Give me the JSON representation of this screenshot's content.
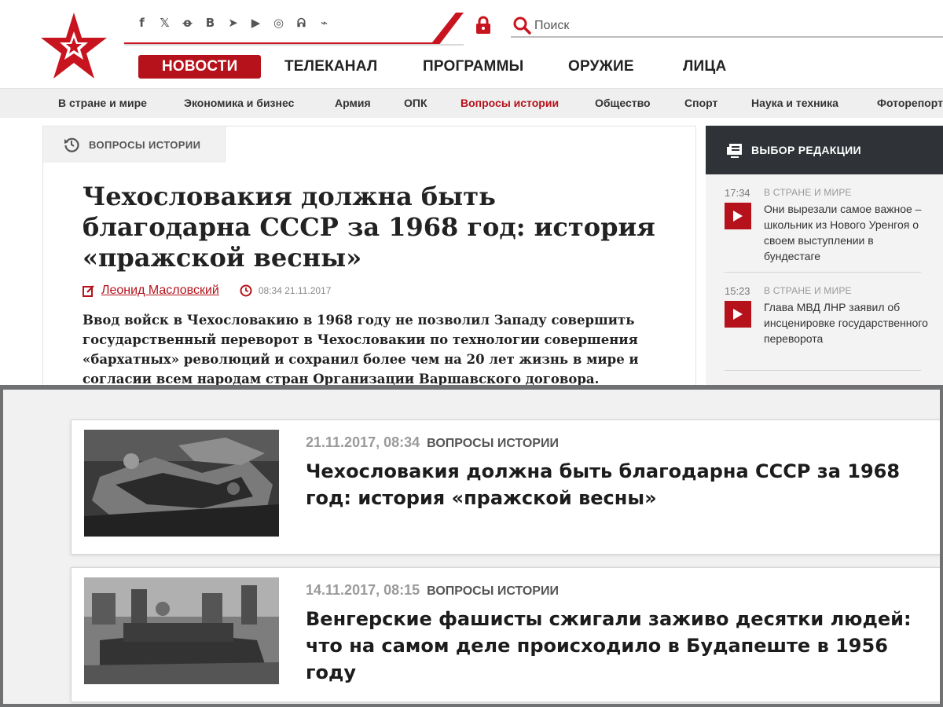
{
  "header": {
    "social_icons": [
      "facebook-icon",
      "twitter-icon",
      "odnoklassniki-icon",
      "vkontakte-icon",
      "telegram-icon",
      "youtube-icon",
      "instagram-icon",
      "yandex-zen-icon",
      "rss-icon"
    ],
    "social_glyphs": [
      "f",
      "𝕏",
      "ꝋ",
      "B",
      "➤",
      "▶",
      "◎",
      "ᕱ",
      "⌁"
    ],
    "search_placeholder": "Поиск"
  },
  "main_nav": [
    {
      "label": "НОВОСТИ",
      "active": true
    },
    {
      "label": "ТЕЛЕКАНАЛ",
      "active": false
    },
    {
      "label": "ПРОГРАММЫ",
      "active": false
    },
    {
      "label": "ОРУЖИЕ",
      "active": false
    },
    {
      "label": "ЛИЦА",
      "active": false
    }
  ],
  "sub_nav": [
    {
      "label": "В стране и мире",
      "active": false
    },
    {
      "label": "Экономика и бизнес",
      "active": false
    },
    {
      "label": "Армия",
      "active": false
    },
    {
      "label": "ОПК",
      "active": false
    },
    {
      "label": "Вопросы истории",
      "active": true
    },
    {
      "label": "Общество",
      "active": false
    },
    {
      "label": "Спорт",
      "active": false
    },
    {
      "label": "Наука и техника",
      "active": false
    },
    {
      "label": "Фоторепортаж",
      "active": false
    }
  ],
  "article": {
    "rubric": "ВОПРОСЫ ИСТОРИИ",
    "title": "Чехословакия должна быть благодарна СССР за 1968 год: история «пражской весны»",
    "author": "Леонид Масловский",
    "datetime": "08:34 21.11.2017",
    "lead": "Ввод войск в Чехословакию в 1968 году не позволил Западу совершить государственный переворот в Чехословакии по технологии совершения «бархатных» революций и сохранил более чем на 20 лет жизнь в мире и согласии всем народам стран Организации Варшавского договора."
  },
  "editors_choice": {
    "heading": "ВЫБОР РЕДАКЦИИ",
    "items": [
      {
        "time": "17:34",
        "tag": "В СТРАНЕ И МИРЕ",
        "text": "Они вырезали самое важное – школьник из Нового Уренгоя о своем выступлении в бундестаге"
      },
      {
        "time": "15:23",
        "tag": "В СТРАНЕ И МИРЕ",
        "text": "Глава МВД ЛНР заявил об инсценировке государственного переворота"
      }
    ]
  },
  "list": [
    {
      "date": "21.11.2017, 08:34",
      "rubric": "ВОПРОСЫ ИСТОРИИ",
      "title": "Чехословакия должна быть благодарна СССР за 1968 год: история «пражской весны»"
    },
    {
      "date": "14.11.2017, 08:15",
      "rubric": "ВОПРОСЫ ИСТОРИИ",
      "title": "Венгерские фашисты сжигали заживо десятки людей: что на самом деле происходило в Будапеште в 1956 году"
    }
  ],
  "colors": {
    "brand_red": "#b5121b",
    "dark_panel": "#2f3237",
    "divider": "#6f7173"
  }
}
